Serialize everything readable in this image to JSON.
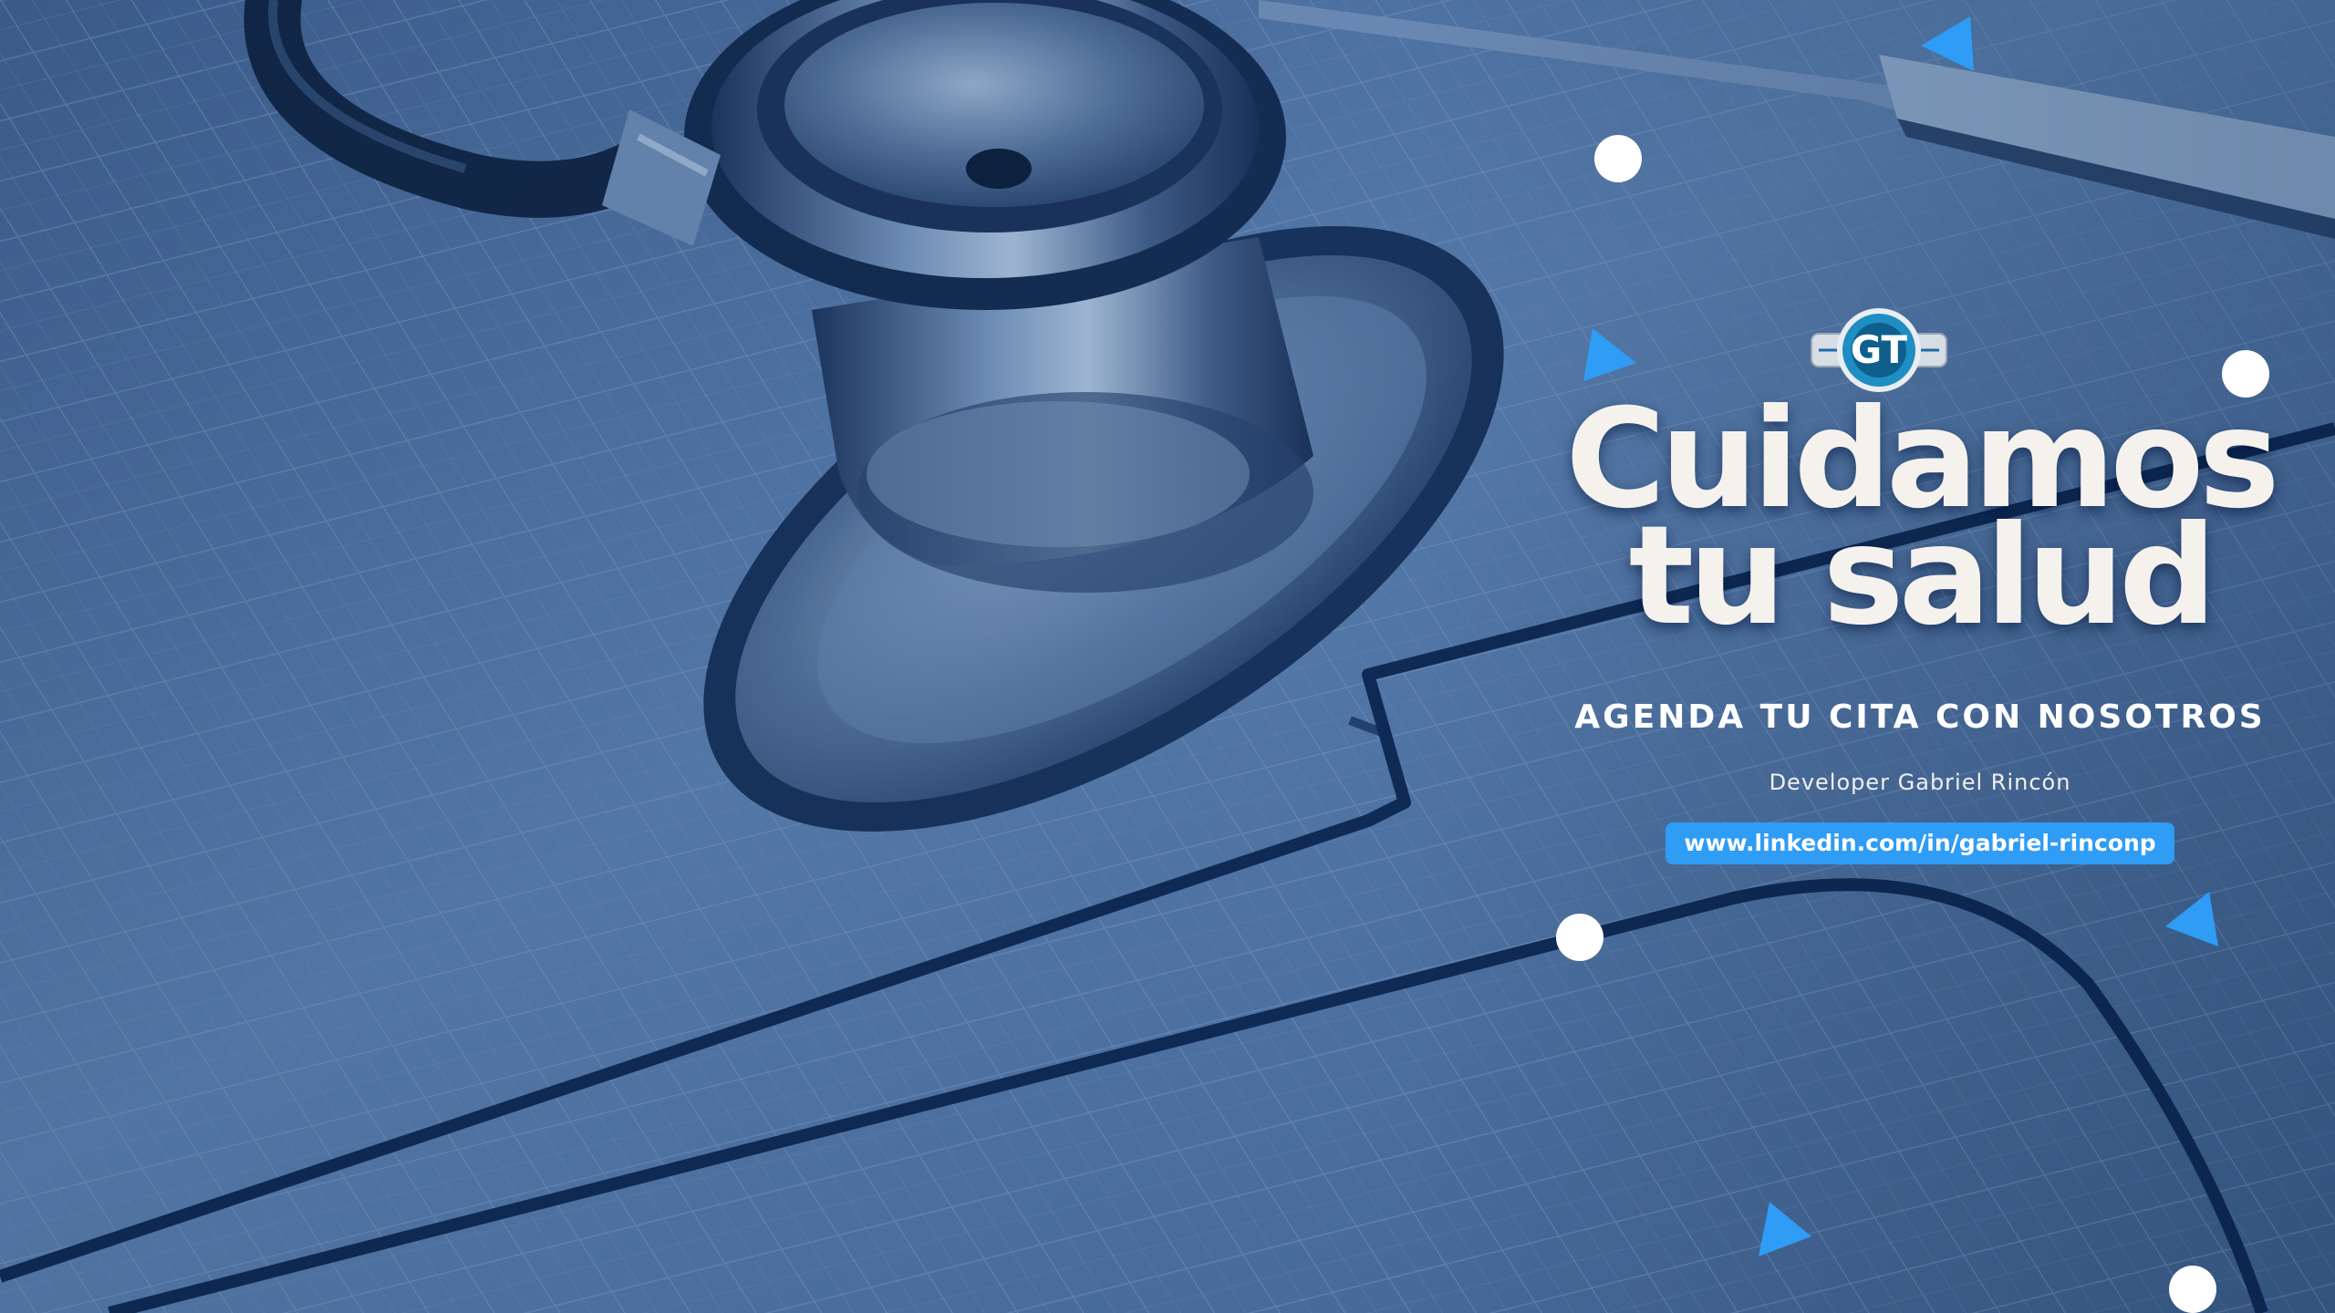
{
  "hero": {
    "headline_line1": "Cuidamos",
    "headline_line2": "tu salud",
    "tagline": "AGENDA TU CITA CON NOSOTROS",
    "developer": "Developer Gabriel Rincón",
    "link": "www.linkedin.com/in/gabriel-rinconp"
  },
  "logo": {
    "letters": "GT",
    "icon": "heartbeat-logo-icon"
  },
  "colors": {
    "background_tint": "#4a6a98",
    "dark_line": "#0e2a55",
    "accent_blue": "#2f9cf5",
    "headline": "#f5f2ee"
  }
}
